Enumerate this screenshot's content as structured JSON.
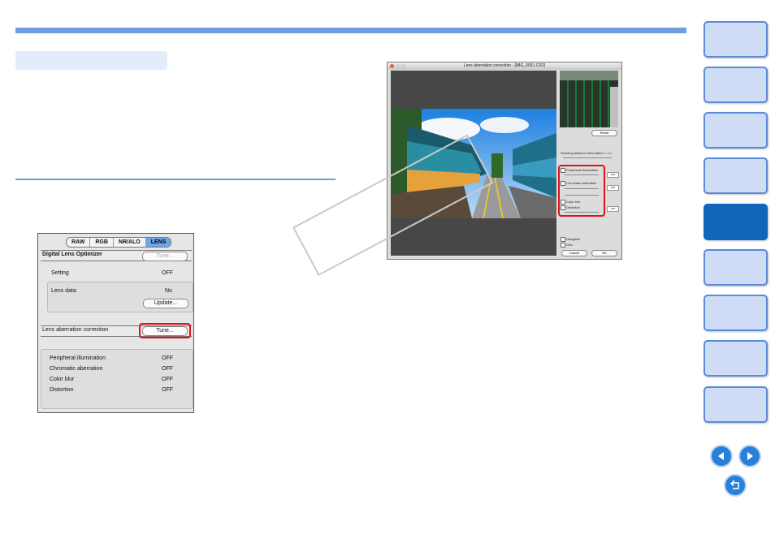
{
  "lens_panel": {
    "tabs": [
      "RAW",
      "RGB",
      "NR/ALO",
      "LENS"
    ],
    "active_tab": "LENS",
    "digital_lens_optimizer": {
      "label": "Digital Lens Optimizer",
      "tune_label": "Tune...",
      "setting_label": "Setting",
      "setting_value": "OFF",
      "lens_data_label": "Lens data",
      "lens_data_value": "No",
      "update_label": "Update..."
    },
    "lens_aberration": {
      "label": "Lens aberration correction",
      "tune_label": "Tune...",
      "items": [
        {
          "label": "Peripheral illumination",
          "value": "OFF"
        },
        {
          "label": "Chromatic aberration",
          "value": "OFF"
        },
        {
          "label": "Color blur",
          "value": "OFF"
        },
        {
          "label": "Distortion",
          "value": "OFF"
        }
      ]
    }
  },
  "dialog": {
    "title": "Lens aberration correction - [IMG_0001.CR2]",
    "reset_label": "Reset",
    "shooting_distance_label": "Shooting distance information × 1.x",
    "options": [
      {
        "label": "Peripheral illumination",
        "value": "100"
      },
      {
        "label": "Chromatic aberration",
        "value": "100"
      },
      {
        "label": "Color blur",
        "value": ""
      },
      {
        "label": "Distortion",
        "value": "100"
      }
    ],
    "navigator_label": "Navigator",
    "grid_label": "Grid",
    "cancel_label": "Cancel",
    "ok_label": "OK"
  },
  "colors": {
    "accent": "#6f9fe0",
    "nav_active": "#1166bb",
    "highlight": "#e0101a"
  },
  "icons": {
    "prev": "arrow-left-icon",
    "next": "arrow-right-icon",
    "back": "return-icon"
  }
}
